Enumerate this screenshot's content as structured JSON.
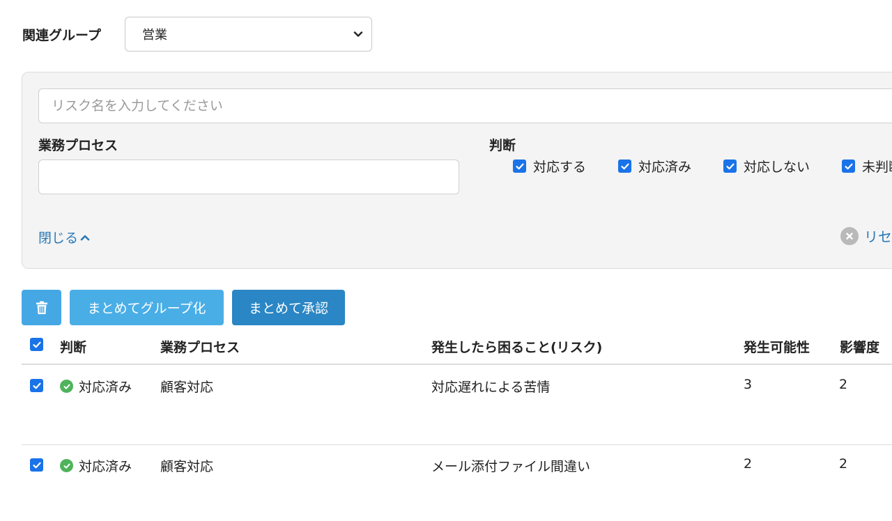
{
  "group": {
    "label": "関連グループ",
    "selected": "営業"
  },
  "filter": {
    "risk_placeholder": "リスク名を入力してください",
    "process_label": "業務プロセス",
    "process_value": "",
    "judge_label": "判断",
    "judge_options": [
      {
        "label": "対応する",
        "checked": true
      },
      {
        "label": "対応済み",
        "checked": true
      },
      {
        "label": "対応しない",
        "checked": true
      },
      {
        "label": "未判断",
        "checked": true
      }
    ],
    "close_label": "閉じる",
    "reset_label": "リセット"
  },
  "actions": {
    "trash_icon": "trash-icon",
    "group_label": "まとめてグループ化",
    "approve_label": "まとめて承認"
  },
  "table": {
    "headers": {
      "judge": "判断",
      "process": "業務プロセス",
      "risk": "発生したら困ること(リスク)",
      "likelihood": "発生可能性",
      "impact": "影響度"
    },
    "rows": [
      {
        "checked": true,
        "status": "対応済み",
        "process": "顧客対応",
        "risk": "対応遅れによる苦情",
        "likelihood": "3",
        "impact": "2"
      },
      {
        "checked": true,
        "status": "対応済み",
        "process": "顧客対応",
        "risk": "メール添付ファイル間違い",
        "likelihood": "2",
        "impact": "2"
      }
    ]
  },
  "colors": {
    "accent_blue": "#1a73e8",
    "link": "#2a78b5",
    "button_light": "#4aaee6",
    "button_dark": "#2a86c4",
    "success": "#4fb35c"
  }
}
